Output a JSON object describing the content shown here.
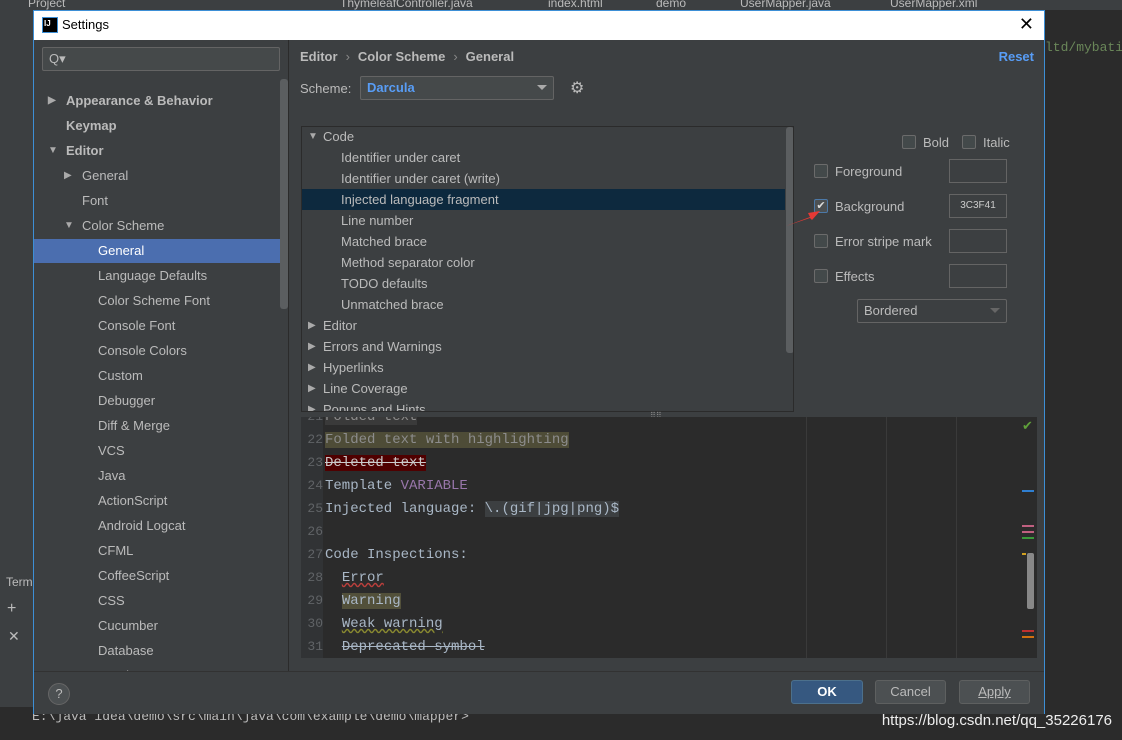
{
  "ide": {
    "tabs": [
      "Project",
      "ThymeleafController.java",
      "index.html",
      "demo",
      "UserMapper.java",
      "UserMapper.xml"
    ],
    "right_code": "ltd/mybati",
    "terminal_label": "Term",
    "terminal_path": "E:\\java idea\\demo\\src\\main\\java\\com\\example\\demo\\mapper>",
    "watermark": "https://blog.csdn.net/qq_35226176"
  },
  "dialog": {
    "title": "Settings",
    "close_icon": "close-icon",
    "search_placeholder": "Q▾",
    "sidebar": [
      {
        "label": "Appearance & Behavior",
        "level": 0,
        "arrow": "▶",
        "bold": true
      },
      {
        "label": "Keymap",
        "level": 0,
        "arrow": "",
        "bold": true
      },
      {
        "label": "Editor",
        "level": 0,
        "arrow": "▼",
        "bold": true
      },
      {
        "label": "General",
        "level": 1,
        "arrow": "▶"
      },
      {
        "label": "Font",
        "level": 1,
        "arrow": ""
      },
      {
        "label": "Color Scheme",
        "level": 1,
        "arrow": "▼"
      },
      {
        "label": "General",
        "level": 2,
        "arrow": "",
        "selected": true
      },
      {
        "label": "Language Defaults",
        "level": 2,
        "arrow": ""
      },
      {
        "label": "Color Scheme Font",
        "level": 2,
        "arrow": ""
      },
      {
        "label": "Console Font",
        "level": 2,
        "arrow": ""
      },
      {
        "label": "Console Colors",
        "level": 2,
        "arrow": ""
      },
      {
        "label": "Custom",
        "level": 2,
        "arrow": ""
      },
      {
        "label": "Debugger",
        "level": 2,
        "arrow": ""
      },
      {
        "label": "Diff & Merge",
        "level": 2,
        "arrow": ""
      },
      {
        "label": "VCS",
        "level": 2,
        "arrow": ""
      },
      {
        "label": "Java",
        "level": 2,
        "arrow": ""
      },
      {
        "label": "ActionScript",
        "level": 2,
        "arrow": ""
      },
      {
        "label": "Android Logcat",
        "level": 2,
        "arrow": ""
      },
      {
        "label": "CFML",
        "level": 2,
        "arrow": ""
      },
      {
        "label": "CoffeeScript",
        "level": 2,
        "arrow": ""
      },
      {
        "label": "CSS",
        "level": 2,
        "arrow": ""
      },
      {
        "label": "Cucumber",
        "level": 2,
        "arrow": ""
      },
      {
        "label": "Database",
        "level": 2,
        "arrow": ""
      },
      {
        "label": "Drools",
        "level": 2,
        "arrow": ""
      }
    ],
    "breadcrumb": [
      "Editor",
      "Color Scheme",
      "General"
    ],
    "reset": "Reset",
    "scheme_label": "Scheme:",
    "scheme_value": "Darcula",
    "tree": [
      {
        "label": "Code",
        "level": 0,
        "arrow": "▼"
      },
      {
        "label": "Identifier under caret",
        "level": 1
      },
      {
        "label": "Identifier under caret (write)",
        "level": 1
      },
      {
        "label": "Injected language fragment",
        "level": 1,
        "selected": true
      },
      {
        "label": "Line number",
        "level": 1
      },
      {
        "label": "Matched brace",
        "level": 1
      },
      {
        "label": "Method separator color",
        "level": 1
      },
      {
        "label": "TODO defaults",
        "level": 1
      },
      {
        "label": "Unmatched brace",
        "level": 1
      },
      {
        "label": "Editor",
        "level": 0,
        "arrow": "▶"
      },
      {
        "label": "Errors and Warnings",
        "level": 0,
        "arrow": "▶"
      },
      {
        "label": "Hyperlinks",
        "level": 0,
        "arrow": "▶"
      },
      {
        "label": "Line Coverage",
        "level": 0,
        "arrow": "▶"
      },
      {
        "label": "Popups and Hints",
        "level": 0,
        "arrow": "▶"
      }
    ],
    "options": {
      "bold": "Bold",
      "bold_checked": false,
      "italic": "Italic",
      "italic_checked": false,
      "foreground": "Foreground",
      "foreground_checked": false,
      "foreground_value": "",
      "background": "Background",
      "background_checked": true,
      "background_value": "3C3F41",
      "error_stripe": "Error stripe mark",
      "error_stripe_checked": false,
      "error_stripe_value": "",
      "effects": "Effects",
      "effects_checked": false,
      "effects_value": "",
      "effect_type": "Bordered"
    },
    "preview": [
      {
        "n": "21",
        "text": "Folded text",
        "style": "folded"
      },
      {
        "n": "22",
        "text": "Folded text with highlighting",
        "style": "folded-hl"
      },
      {
        "n": "23",
        "text": "Deleted text",
        "style": "deleted"
      },
      {
        "n": "24",
        "pre": "Template ",
        "text": "VARIABLE",
        "style": "template"
      },
      {
        "n": "25",
        "pre": "Injected language: ",
        "text": "\\.(gif|jpg|png)$",
        "style": "injected"
      },
      {
        "n": "26",
        "text": "",
        "style": ""
      },
      {
        "n": "27",
        "text": "Code Inspections:",
        "style": ""
      },
      {
        "n": "28",
        "pre": "  ",
        "text": "Error",
        "style": "error"
      },
      {
        "n": "29",
        "pre": "  ",
        "text": "Warning",
        "style": "warning"
      },
      {
        "n": "30",
        "pre": "  ",
        "text": "Weak warning",
        "style": "weak"
      },
      {
        "n": "31",
        "pre": "  ",
        "text": "Deprecated symbol",
        "style": "deprecated"
      }
    ],
    "buttons": {
      "help": "?",
      "ok": "OK",
      "cancel": "Cancel",
      "apply": "Apply"
    },
    "colors": {
      "accent": "#589df6",
      "selection": "#4b6eaf",
      "tree_selection": "#0d293e",
      "ok": "#365880"
    }
  }
}
